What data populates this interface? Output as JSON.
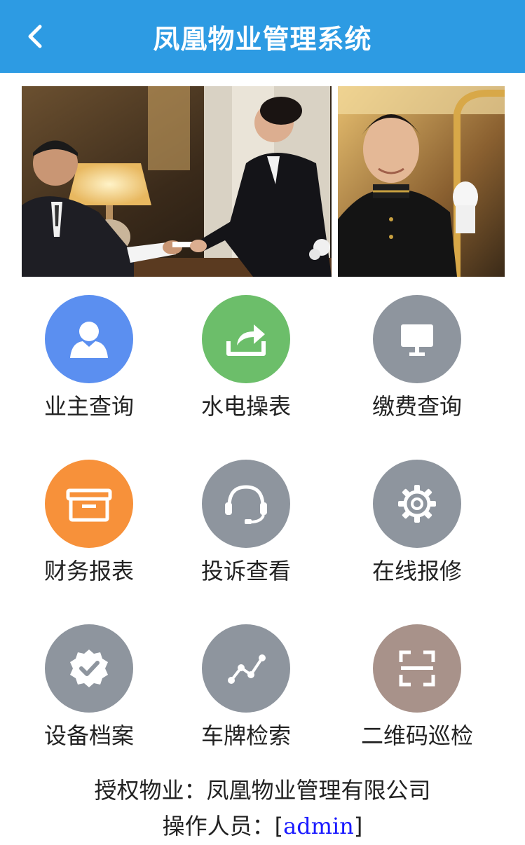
{
  "header": {
    "title": "凤凰物业管理系统",
    "back_icon": "chevron-left-icon"
  },
  "banner": {
    "left_alt": "reception-photo",
    "right_alt": "doorman-photo"
  },
  "menu": [
    {
      "label": "业主查询",
      "icon": "user-icon",
      "color": "#5b8ff0"
    },
    {
      "label": "水电操表",
      "icon": "share-arrow-icon",
      "color": "#6cbe6a"
    },
    {
      "label": "缴费查询",
      "icon": "monitor-icon",
      "color": "#8e959e"
    },
    {
      "label": "财务报表",
      "icon": "inbox-tray-icon",
      "color": "#f7913a"
    },
    {
      "label": "投诉查看",
      "icon": "headset-icon",
      "color": "#8e959e"
    },
    {
      "label": "在线报修",
      "icon": "gear-icon",
      "color": "#8e959e"
    },
    {
      "label": "设备档案",
      "icon": "verified-badge-icon",
      "color": "#8e959e"
    },
    {
      "label": "车牌检索",
      "icon": "trend-line-icon",
      "color": "#8e959e"
    },
    {
      "label": "二维码巡检",
      "icon": "scan-frame-icon",
      "color": "#a8928a"
    }
  ],
  "footer": {
    "company_label": "授权物业：",
    "company_name": "凤凰物业管理有限公司",
    "operator_label": "操作人员：",
    "operator_open": "[",
    "operator_name": "admin",
    "operator_close": "]"
  }
}
